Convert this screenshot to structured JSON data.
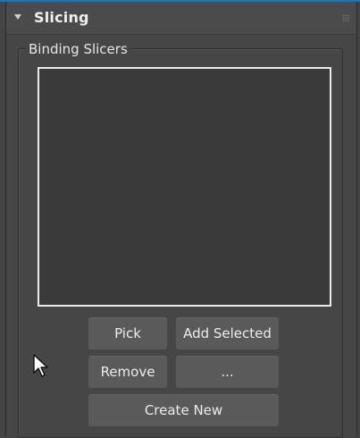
{
  "rollout": {
    "title": "Slicing"
  },
  "group": {
    "label": "Binding Slicers"
  },
  "listbox": {
    "items": []
  },
  "buttons": {
    "pick": "Pick",
    "add_selected": "Add Selected",
    "remove": "Remove",
    "more": "...",
    "create_new": "Create New"
  },
  "icons": {
    "collapse": "triangle-down-icon",
    "grip": "drag-grip-icon",
    "cursor": "mouse-pointer-icon"
  },
  "colors": {
    "panel_bg": "#464646",
    "button_bg": "#5a5a5a",
    "listbox_bg": "#3a3a3a",
    "listbox_border": "#ececec",
    "accent_strip": "#2f6ea8"
  }
}
